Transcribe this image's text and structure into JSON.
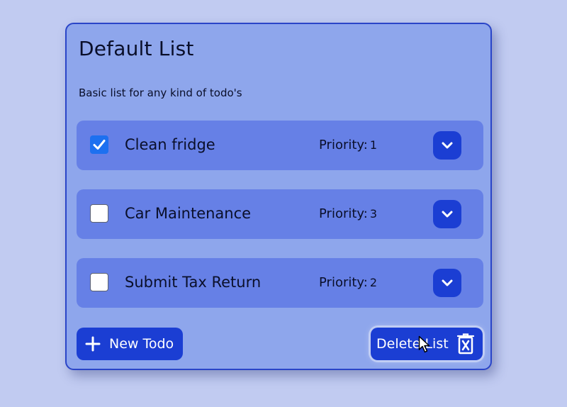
{
  "list": {
    "title": "Default List",
    "description": "Basic list for any kind of todo's"
  },
  "todos": [
    {
      "name": "Clean fridge",
      "priority_label": "Priority:",
      "priority": "1",
      "completed": true
    },
    {
      "name": "Car Maintenance",
      "priority_label": "Priority:",
      "priority": "3",
      "completed": false
    },
    {
      "name": "Submit Tax Return",
      "priority_label": "Priority:",
      "priority": "2",
      "completed": false
    }
  ],
  "actions": {
    "new_todo_label": "New Todo",
    "delete_list_label": "Delete List"
  },
  "icons": {
    "check": "check-icon",
    "expand": "chevron-down-icon",
    "new": "plus-icon",
    "delete": "trash-icon",
    "cursor": "mouse-pointer-icon"
  },
  "colors": {
    "background": "#c1cbf1",
    "card": "#8ea6ec",
    "card_border": "#2a45c8",
    "todo_row": "#6680e6",
    "button": "#1b3ed3",
    "checkbox_checked": "#1d70f0"
  }
}
